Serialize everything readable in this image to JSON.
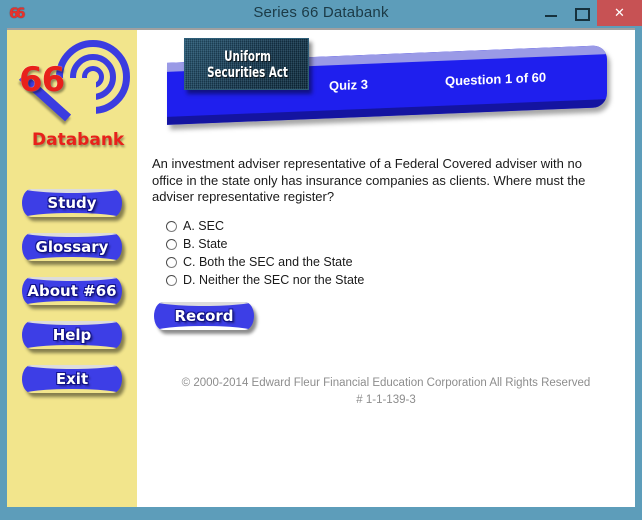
{
  "window": {
    "title": "Series 66 Databank",
    "app_icon": "66",
    "icon_name": "series66-app-icon",
    "controls": {
      "minimize": "–",
      "maximize": "□",
      "close": "✕"
    },
    "frame_color": "#5d9dba",
    "close_button_color": "#c75254"
  },
  "sidebar": {
    "background_color": "#f2e58c",
    "logo": {
      "number": "66",
      "wordmark": "Databank",
      "accent_color": "#e8211b",
      "ring_color": "#3b3ce0"
    },
    "buttons": [
      {
        "label": "Study",
        "name": "study-button"
      },
      {
        "label": "Glossary",
        "name": "glossary-button"
      },
      {
        "label": "About  #66",
        "name": "about-button"
      },
      {
        "label": "Help",
        "name": "help-button"
      },
      {
        "label": "Exit",
        "name": "exit-button"
      }
    ]
  },
  "header": {
    "plate_line1": "Uniform",
    "plate_line2": "Securities Act",
    "quiz": "Quiz 3",
    "question_counter": "Question 1 of 60",
    "ribbon_color": "#1f1fee",
    "plate_color": "#1e3f55"
  },
  "question": {
    "text": "An investment adviser representative of a Federal Covered adviser with no office in the state only has insurance companies as clients. Where must the adviser representative register?",
    "options": [
      {
        "label": "A. SEC",
        "selected": false
      },
      {
        "label": "B. State",
        "selected": false
      },
      {
        "label": "C. Both the SEC and the State",
        "selected": false
      },
      {
        "label": "D. Neither the SEC nor the State",
        "selected": false
      }
    ]
  },
  "actions": {
    "record_label": "Record"
  },
  "footer": {
    "line1": "© 2000-2014 Edward Fleur Financial Education Corporation   All Rights Reserved",
    "line2": "# 1-1-139-3"
  }
}
